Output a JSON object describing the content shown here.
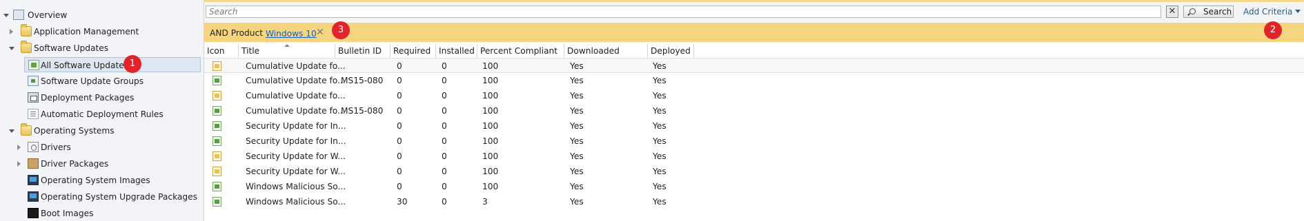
{
  "nav": {
    "overview": "Overview",
    "application_management": "Application Management",
    "software_updates": "Software Updates",
    "all_software_updates": "All Software Updates",
    "software_update_groups": "Software Update Groups",
    "deployment_packages": "Deployment Packages",
    "automatic_deployment_rules": "Automatic Deployment Rules",
    "operating_systems": "Operating Systems",
    "drivers": "Drivers",
    "driver_packages": "Driver Packages",
    "operating_system_images": "Operating System Images",
    "operating_system_upgrade_packages": "Operating System Upgrade Packages",
    "boot_images": "Boot Images"
  },
  "badges": {
    "b1": "1",
    "b2": "2",
    "b3": "3"
  },
  "search": {
    "placeholder": "Search",
    "clear_label": "✕",
    "button_label": "Search",
    "add_criteria": "Add Criteria"
  },
  "criteria": {
    "prefix": "AND Product",
    "value": "Windows 10",
    "remove": "✕"
  },
  "grid": {
    "columns": [
      "Icon",
      "Title",
      "Bulletin ID",
      "Required",
      "Installed",
      "Percent Compliant",
      "Downloaded",
      "Deployed"
    ],
    "rows": [
      {
        "icon": "update-icon-yellow",
        "title": "Cumulative Update fo...",
        "bulletin": "",
        "required": "0",
        "installed": "0",
        "percent": "100",
        "downloaded": "Yes",
        "deployed": "Yes"
      },
      {
        "icon": "update-icon-green",
        "title": "Cumulative Update fo...",
        "bulletin": "MS15-080",
        "required": "0",
        "installed": "0",
        "percent": "100",
        "downloaded": "Yes",
        "deployed": "Yes"
      },
      {
        "icon": "update-icon-yellow",
        "title": "Cumulative Update fo...",
        "bulletin": "",
        "required": "0",
        "installed": "0",
        "percent": "100",
        "downloaded": "Yes",
        "deployed": "Yes"
      },
      {
        "icon": "update-icon-green",
        "title": "Cumulative Update fo...",
        "bulletin": "MS15-080",
        "required": "0",
        "installed": "0",
        "percent": "100",
        "downloaded": "Yes",
        "deployed": "Yes"
      },
      {
        "icon": "update-icon-green",
        "title": "Security Update for In...",
        "bulletin": "",
        "required": "0",
        "installed": "0",
        "percent": "100",
        "downloaded": "Yes",
        "deployed": "Yes"
      },
      {
        "icon": "update-icon-green",
        "title": "Security Update for In...",
        "bulletin": "",
        "required": "0",
        "installed": "0",
        "percent": "100",
        "downloaded": "Yes",
        "deployed": "Yes"
      },
      {
        "icon": "update-icon-yellow",
        "title": "Security Update for W...",
        "bulletin": "",
        "required": "0",
        "installed": "0",
        "percent": "100",
        "downloaded": "Yes",
        "deployed": "Yes"
      },
      {
        "icon": "update-icon-yellow",
        "title": "Security Update for W...",
        "bulletin": "",
        "required": "0",
        "installed": "0",
        "percent": "100",
        "downloaded": "Yes",
        "deployed": "Yes"
      },
      {
        "icon": "update-icon-green",
        "title": "Windows Malicious So...",
        "bulletin": "",
        "required": "0",
        "installed": "0",
        "percent": "100",
        "downloaded": "Yes",
        "deployed": "Yes"
      },
      {
        "icon": "update-icon-green",
        "title": "Windows Malicious So...",
        "bulletin": "",
        "required": "30",
        "installed": "0",
        "percent": "3",
        "downloaded": "Yes",
        "deployed": "Yes"
      }
    ]
  },
  "colors": {
    "criteria_bar": "#f6d580",
    "badge": "#e0242a",
    "link": "#1a5fb4",
    "selection": "#dde6f1"
  }
}
